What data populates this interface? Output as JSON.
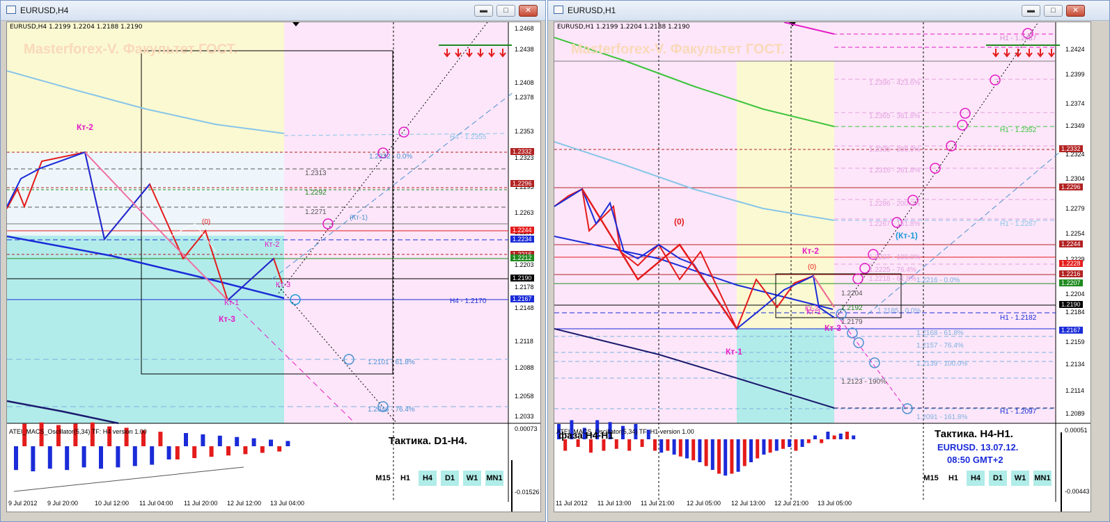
{
  "left": {
    "title": "EURUSD,H4",
    "info": "EURUSD,H4  1.2199 1.2204 1.2188 1.2190",
    "watermark": "Masterforex-V. Факультет ГОСТ.",
    "price_ticks": [
      "1.2468",
      "1.2438",
      "1.2408",
      "1.2378",
      "1.2353",
      "1.2323",
      "1.2293",
      "1.2263",
      "1.2233",
      "1.2203",
      "1.2178",
      "1.2148",
      "1.2118",
      "1.2088",
      "1.2058",
      "1.2033"
    ],
    "price_boxes": [
      {
        "text": "1.2332",
        "color": "#b22222"
      },
      {
        "text": "1.2296",
        "color": "#b22222"
      },
      {
        "text": "1.2244",
        "color": "#e41b1b"
      },
      {
        "text": "1.2234",
        "color": "#1a2bd8"
      },
      {
        "text": "1.2216",
        "color": "#b22222"
      },
      {
        "text": "1.2212",
        "color": "#1e8a1e"
      },
      {
        "text": "1.2190",
        "color": "#000000"
      },
      {
        "text": "1.2167",
        "color": "#1a2bd8"
      }
    ],
    "annotations": [
      "1.2313",
      "1.2292",
      "1.2271",
      "1.2332 - 0.0%",
      "1.2101 - 61.8%",
      "1.2046 - 76.4%",
      "H4 - 1.2355",
      "H4 - 1.2170",
      "(Кт-1)",
      "(0)"
    ],
    "kt_labels": [
      "Кт-2",
      "Кт-2",
      "Кт-3",
      "Кт-1",
      "Кт-3"
    ],
    "time_ticks": [
      "9 Jul 2012",
      "9 Jul 20:00",
      "10 Jul 12:00",
      "11 Jul 04:00",
      "11 Jul 20:00",
      "12 Jul 12:00",
      "13 Jul 04:00"
    ],
    "indicator_label": "ATEI_MACS_Oscillator(5,34) TF: H4 version 1.00",
    "indicator_ticks": [
      "0.00073",
      "-0.01526"
    ],
    "tactic": "Тактика. D1-H4.",
    "tf_buttons": [
      "M15",
      "H1",
      "H4",
      "D1",
      "W1",
      "MN1"
    ],
    "tf_active": [
      "H4",
      "D1",
      "W1",
      "MN1"
    ],
    "histogram": [
      -0.9,
      0.85,
      -0.95,
      0.9,
      -0.85,
      0.8,
      -0.9,
      0.85,
      -0.8,
      0.9,
      -0.85,
      0.75,
      -0.8,
      0.7,
      -0.75,
      0.6,
      -0.7,
      0.55,
      -0.5,
      -0.5,
      0.5,
      -0.45,
      0.45,
      -0.4,
      0.4,
      -0.35,
      0.35,
      -0.3,
      0.3,
      -0.25,
      0.25,
      -0.2,
      0.2,
      -0.15,
      0.15,
      -0.1,
      0.1,
      -0.05,
      0.05,
      -0.05,
      0.05,
      -0.05,
      0.02
    ],
    "colors": {
      "pink": "#fde6f9",
      "yellow": "#fbf9d2",
      "cyan": "#b2ecea",
      "lightblue": "#eef6fb"
    }
  },
  "right": {
    "title": "EURUSD,H1",
    "info": "EURUSD,H1  1.2199 1.2204 1.2188 1.2190",
    "watermark": "Masterforex-V. Факультет ГОСТ.",
    "price_ticks": [
      "1.2424",
      "1.2399",
      "1.2374",
      "1.2349",
      "1.2324",
      "1.2304",
      "1.2279",
      "1.2254",
      "1.2229",
      "1.2204",
      "1.2184",
      "1.2159",
      "1.2134",
      "1.2114",
      "1.2089"
    ],
    "price_boxes": [
      {
        "text": "1.2332",
        "color": "#b22222"
      },
      {
        "text": "1.2296",
        "color": "#b22222"
      },
      {
        "text": "1.2244",
        "color": "#b22222"
      },
      {
        "text": "1.2228",
        "color": "#e41b1b"
      },
      {
        "text": "1.2216",
        "color": "#b22222"
      },
      {
        "text": "1.2207",
        "color": "#1e8a1e"
      },
      {
        "text": "1.2190",
        "color": "#000000"
      },
      {
        "text": "1.2167",
        "color": "#1a2bd8"
      }
    ],
    "fib_levels": [
      "H1 - 1.2437",
      "1.2396 - 423.6%",
      "1.2365 - 361.8%",
      "1.2335 - 300.0%",
      "1.2316 - 261.8%",
      "1.2286 - 200.0%",
      "1.2267 - 161.8%",
      "1.2237 - 100.0%",
      "1.2225 - 76.4%",
      "1.2218 - 61.8%",
      "1.2216 - 0.0%",
      "1.2204",
      "1.2192",
      "1.2185 - 0.0%",
      "1.2179",
      "1.2168 - 61.8%",
      "1.2157 - 76.4%",
      "1.2139 - 100.0%",
      "1.2123 - 190%",
      "1.2091 - 161.8%",
      "H1 - 1.2352",
      "H1 - 1.2267",
      "H1 - 1.2182",
      "H1 - 1.2097",
      "(Кт-1)",
      "(0)",
      "(0)",
      "Кт-2"
    ],
    "kt_labels": [
      "Кт-2",
      "Кт-1",
      "Кт-3",
      "Кт-1"
    ],
    "time_ticks": [
      "11 Jul 2012",
      "11 Jul 13:00",
      "11 Jul 21:00",
      "12 Jul 05:00",
      "12 Jul 13:00",
      "12 Jul 21:00",
      "13 Jul 05:00"
    ],
    "indicator_label": "ATEI_MACS_Oscillator(5,34) TF: H1 version 1.00",
    "indicator_overlay": "фаза H4-H1",
    "indicator_ticks": [
      "0.00051",
      "-0.00443"
    ],
    "tactic": "Тактика. H4-H1.",
    "subtitle1": "EURUSD. 13.07.12.",
    "subtitle2": "08:50  GMT+2",
    "tf_buttons": [
      "M15",
      "H1",
      "H4",
      "D1",
      "W1",
      "MN1"
    ],
    "tf_active": [
      "H4",
      "D1",
      "W1",
      "MN1"
    ],
    "histogram": [
      0.4,
      -0.3,
      0.5,
      -0.2,
      0.3,
      -0.35,
      0.5,
      -0.3,
      0.45,
      -0.25,
      0.35,
      -0.3,
      0.4,
      -0.2,
      0.25,
      -0.3,
      -0.35,
      -0.3,
      -0.4,
      -0.45,
      -0.5,
      -0.55,
      -0.6,
      -0.7,
      -0.8,
      -0.9,
      -0.95,
      -0.9,
      -0.85,
      -0.7,
      -0.6,
      -0.5,
      -0.4,
      -0.35,
      -0.3,
      -0.25,
      -0.2,
      -0.3,
      -0.2,
      -0.1,
      0.1,
      -0.1,
      0.2,
      0.1,
      0.15,
      0.2,
      0.1
    ],
    "colors": {
      "pink": "#fde6f9",
      "yellow": "#fbf9d2",
      "cyan": "#b2ecea"
    }
  }
}
